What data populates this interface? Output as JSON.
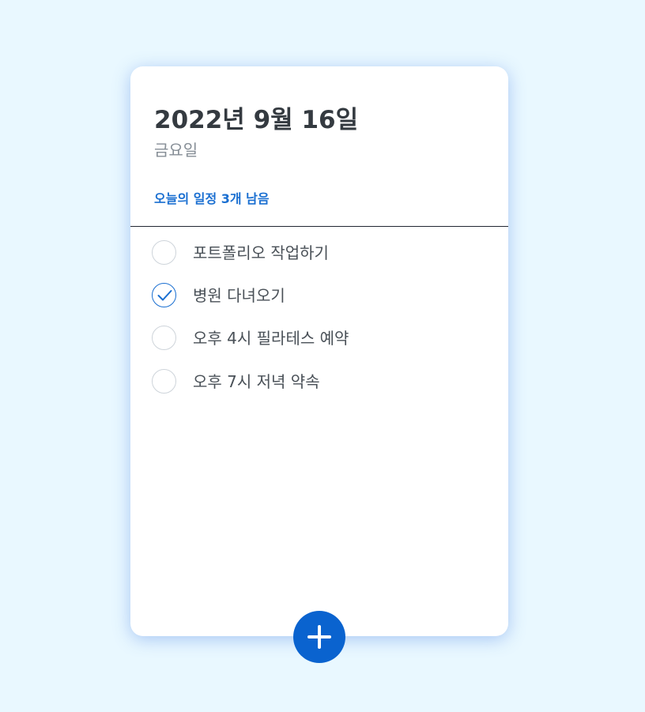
{
  "header": {
    "date": "2022년 9월 16일",
    "weekday": "금요일",
    "remaining_label": "오늘의 일정 3개 남음"
  },
  "todos": [
    {
      "text": "포트폴리오 작업하기",
      "done": false
    },
    {
      "text": "병원 다녀오기",
      "done": true
    },
    {
      "text": "오후 4시 필라테스 예약",
      "done": false
    },
    {
      "text": "오후 7시 저녁 약속",
      "done": false
    }
  ],
  "add_button": {
    "icon": "plus-icon"
  },
  "colors": {
    "background": "#e9f8ff",
    "accent": "#1a6fd1",
    "add_button": "#0a63cf",
    "title": "#343a40",
    "muted": "#868e96"
  }
}
